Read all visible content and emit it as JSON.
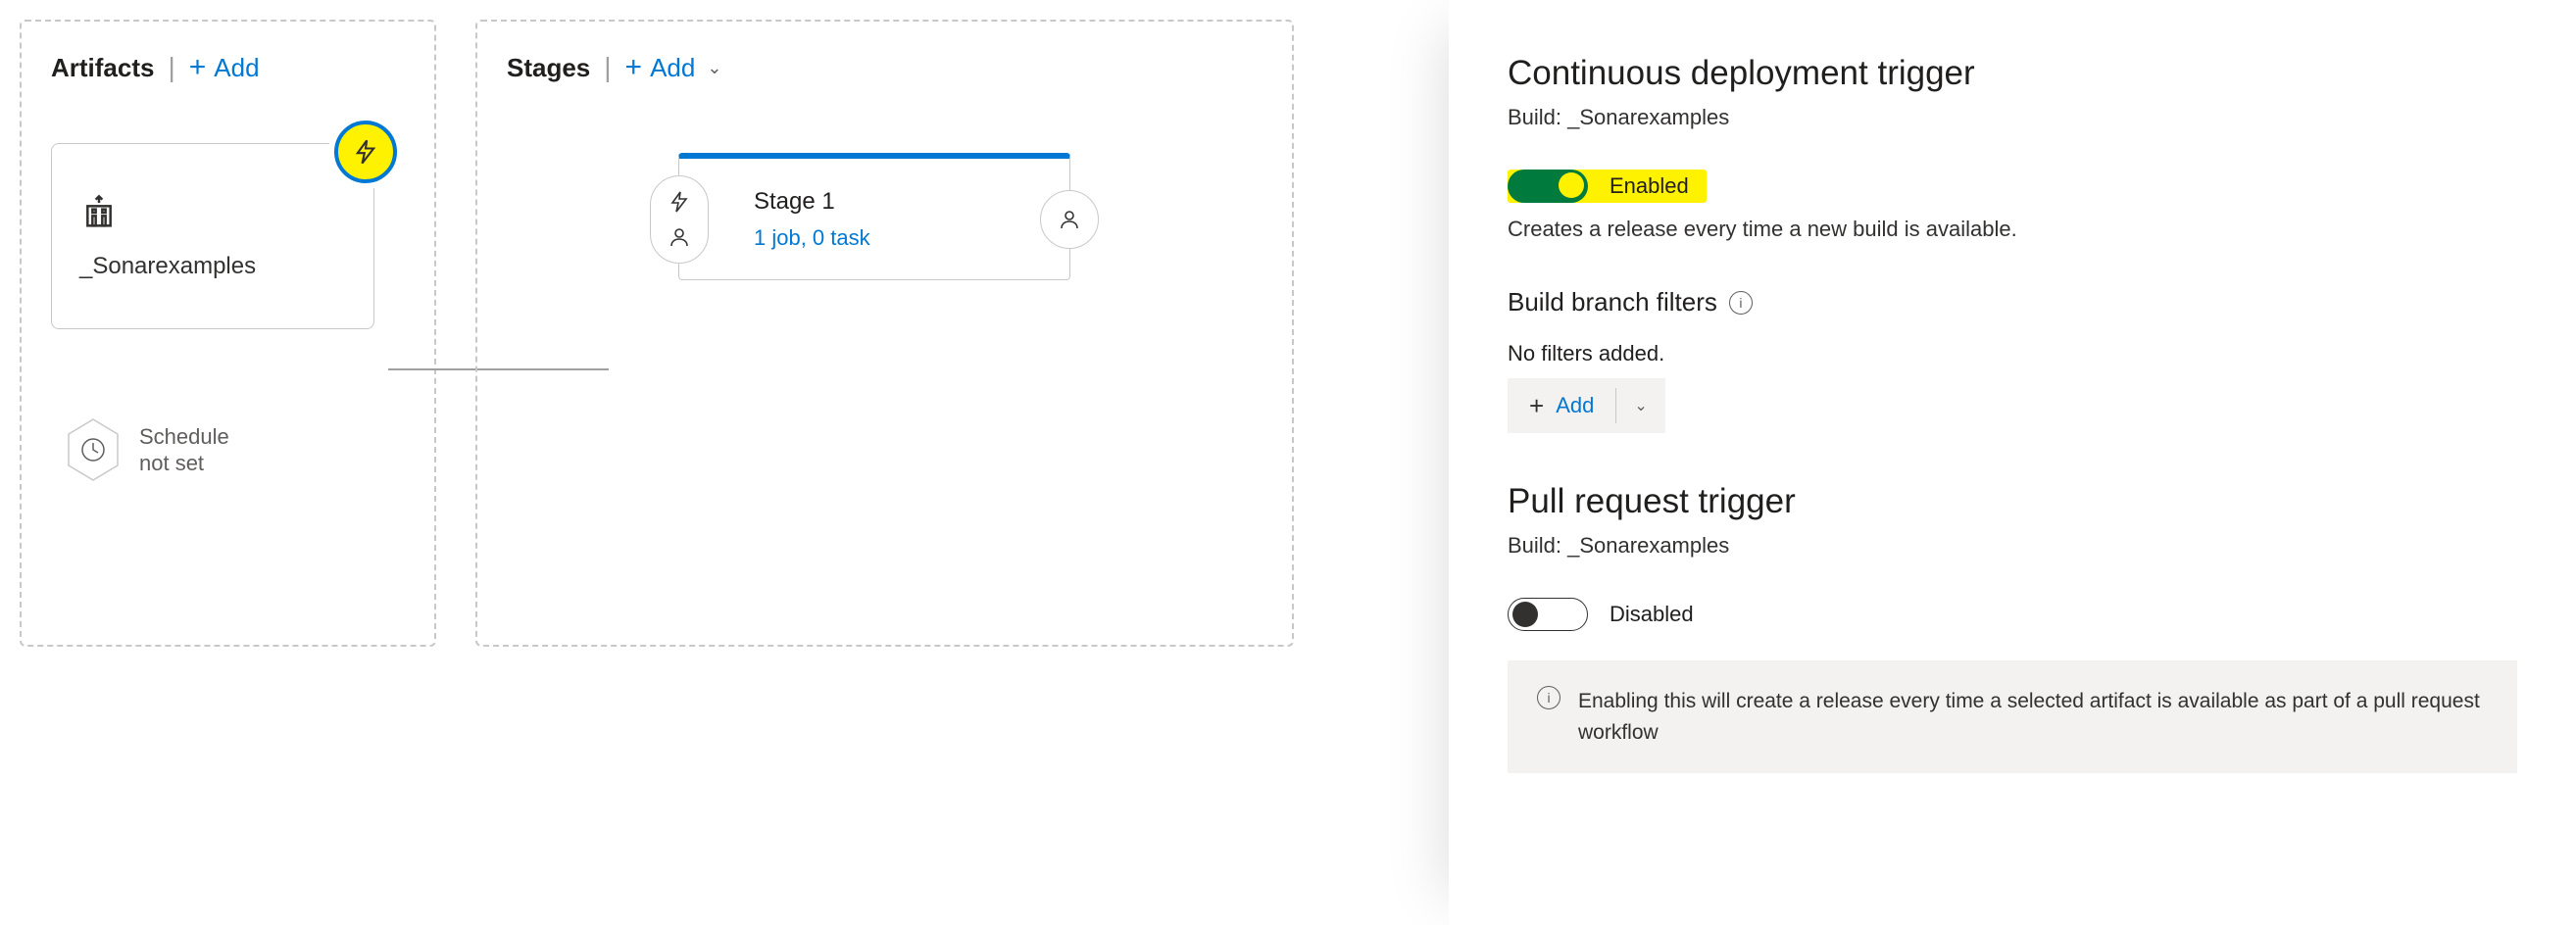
{
  "artifacts": {
    "title": "Artifacts",
    "add_label": "Add",
    "card": {
      "name": "_Sonarexamples"
    },
    "schedule_label": "Schedule\nnot set"
  },
  "stages": {
    "title": "Stages",
    "add_label": "Add",
    "card": {
      "title": "Stage 1",
      "subtitle": "1 job, 0 task"
    }
  },
  "panel": {
    "cd_trigger": {
      "heading": "Continuous deployment trigger",
      "build_label": "Build: _Sonarexamples",
      "toggle_label": "Enabled",
      "desc": "Creates a release every time a new build is available."
    },
    "branch_filters": {
      "heading": "Build branch filters",
      "empty": "No filters added.",
      "add_label": "Add"
    },
    "pr_trigger": {
      "heading": "Pull request trigger",
      "build_label": "Build: _Sonarexamples",
      "toggle_label": "Disabled",
      "info": "Enabling this will create a release every time a selected artifact is available as part of a pull request workflow"
    }
  }
}
